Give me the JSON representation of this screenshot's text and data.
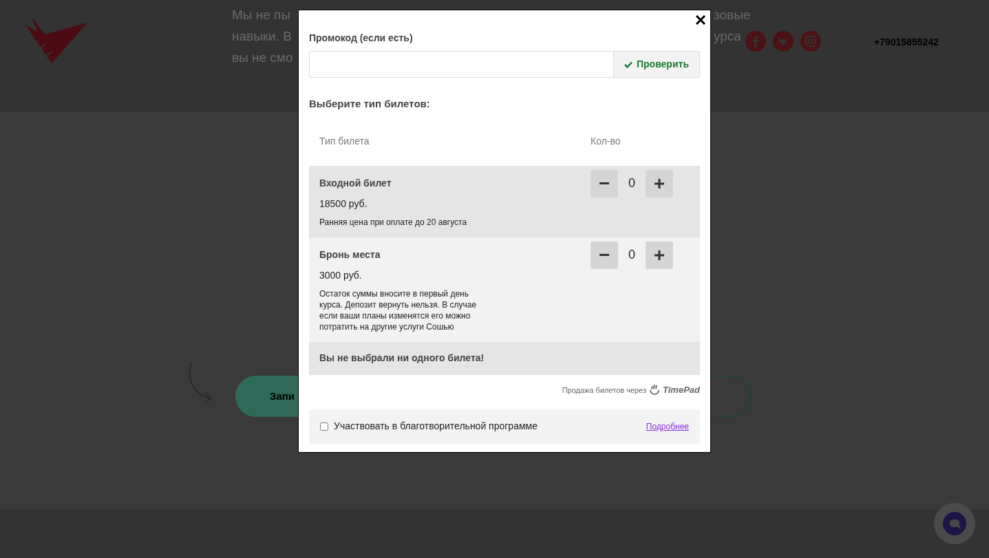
{
  "background": {
    "left_text": [
      "Мы не пы",
      "навыки. В",
      "вы не смо"
    ],
    "right_text": [
      "зовые",
      "урса"
    ],
    "phone": "+79015855242",
    "cta_fragment": "Запи"
  },
  "modal": {
    "promo": {
      "label": "Промокод (если есть)",
      "button": "Проверить"
    },
    "section_title": "Выберите тип билетов:",
    "columns": [
      "Тип билета",
      "Кол-во"
    ],
    "tickets": [
      {
        "name": "Входной билет",
        "price": "18500 руб.",
        "note": "Ранняя цена при оплате до 20 августа",
        "quantity": "0"
      },
      {
        "name": "Бронь места",
        "price": "3000 руб.",
        "note": "Остаток суммы вносите в первый день курса. Депозит вернуть нельзя. В случае если ваши планы изменятся его можно потратить на другие услуги Сошью",
        "quantity": "0"
      }
    ],
    "status": "Вы не выбрали ни одного билета!",
    "powered_by": "Продажа билетов через",
    "provider": "TimePad",
    "charity": {
      "label": "Участвовать в благотворительной программе",
      "checked": false,
      "link": "Подробнее"
    }
  }
}
